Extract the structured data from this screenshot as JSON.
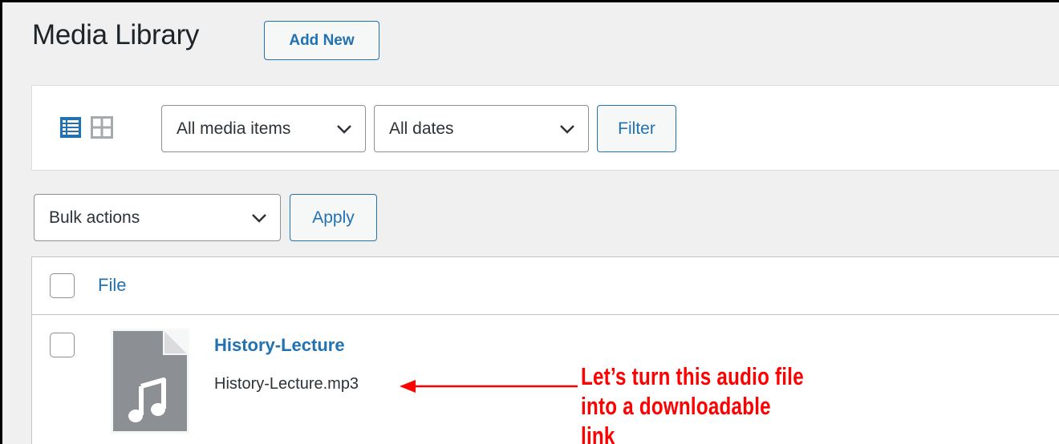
{
  "header": {
    "title": "Media Library",
    "add_new_label": "Add New"
  },
  "toolbar": {
    "view_modes": [
      {
        "icon": "list-view-icon",
        "active": true
      },
      {
        "icon": "grid-view-icon",
        "active": false
      }
    ],
    "media_type_filter": {
      "selected": "All media items"
    },
    "date_filter": {
      "selected": "All dates"
    },
    "filter_label": "Filter"
  },
  "bulk": {
    "selected": "Bulk actions",
    "apply_label": "Apply"
  },
  "table": {
    "columns": [
      "File"
    ],
    "rows": [
      {
        "icon": "audio-file-icon",
        "title": "History-Lecture",
        "filename": "History-Lecture.mp3"
      }
    ]
  },
  "annotation": {
    "lines": [
      "Let’s turn this audio file",
      "into a downloadable link"
    ],
    "color": "#ff0000"
  },
  "colors": {
    "accent": "#2271b1",
    "background": "#f0f0f1"
  }
}
